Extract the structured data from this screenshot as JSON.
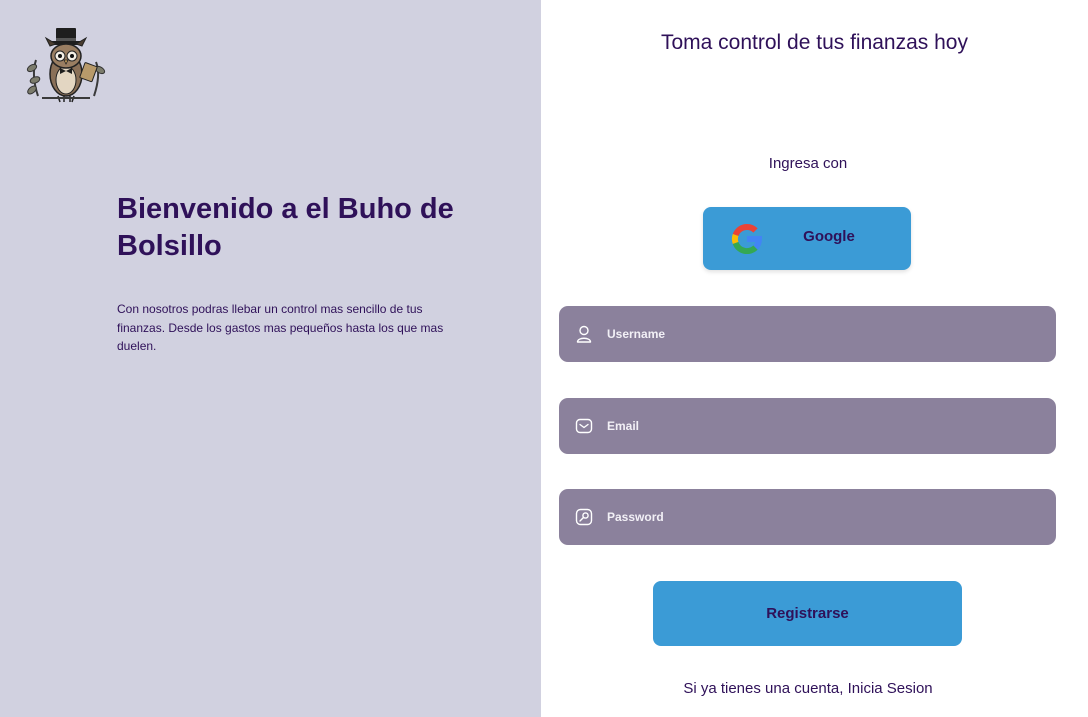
{
  "colors": {
    "left_panel_bg": "#d1d1e0",
    "right_panel_bg": "#ffffff",
    "primary_text": "#2f1159",
    "accent_blue": "#3b9bd6",
    "field_bg": "#8b819c"
  },
  "brand": {
    "logo_icon": "owl-with-top-hat-icon"
  },
  "welcome": {
    "title": "Bienvenido a el Buho de Bolsillo",
    "description": "Con nosotros podras llebar un control mas sencillo de tus finanzas. Desde los gastos mas pequeños hasta los que mas duelen."
  },
  "signup": {
    "title": "Toma control de tus finanzas hoy",
    "login_with": "Ingresa con",
    "google_label": "Google",
    "google_icon": "google-icon",
    "fields": {
      "username": {
        "placeholder": "Username",
        "value": "",
        "icon": "user-icon"
      },
      "email": {
        "placeholder": "Email",
        "value": "",
        "icon": "mail-icon"
      },
      "password": {
        "placeholder": "Password",
        "value": "",
        "icon": "key-icon"
      }
    },
    "register_label": "Registrarse",
    "login_prompt": "Si ya tienes una cuenta, Inicia Sesion"
  }
}
